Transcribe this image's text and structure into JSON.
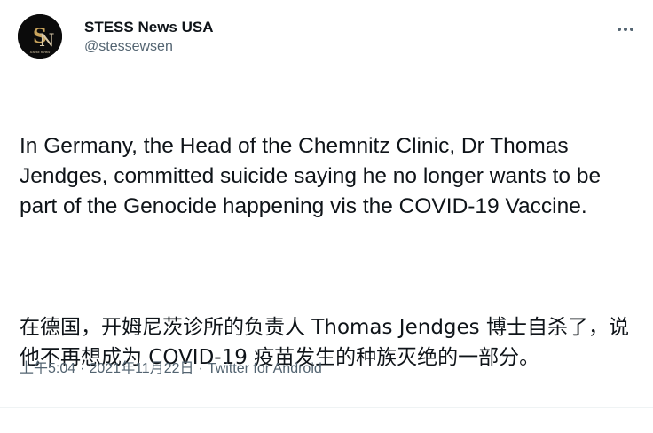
{
  "author": {
    "display_name": "STESS News USA",
    "handle": "@stessewsen",
    "avatar_monogram": "SN",
    "avatar_caption": "Stess news"
  },
  "tweet": {
    "paragraphs": [
      "In Germany, the Head of the Chemnitz Clinic, Dr Thomas Jendges, committed suicide saying he no longer wants to be part of the Genocide happening vis the COVID-19 Vaccine.",
      "在德国，开姆尼茨诊所的负责人 Thomas Jendges 博士自杀了，说他不再想成为 COVID-19 疫苗发生的种族灭绝的一部分。"
    ]
  },
  "meta": {
    "time": "上午5:04",
    "date": "2021年11月22日",
    "separator": "·",
    "source": "Twitter for Android"
  },
  "icons": {
    "more": "more-horizontal-icon"
  },
  "colors": {
    "text_primary": "#0f1419",
    "text_secondary": "#536471",
    "avatar_bg": "#0b0b0b",
    "avatar_gold": "#c9a45c"
  }
}
